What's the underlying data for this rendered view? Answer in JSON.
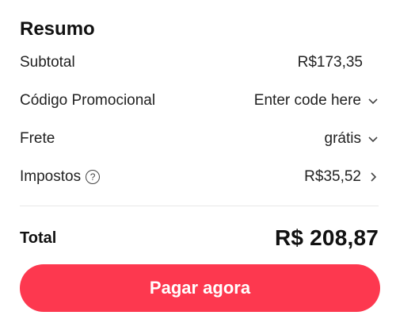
{
  "summary": {
    "title": "Resumo",
    "rows": [
      {
        "label": "Subtotal",
        "value": "R$173,35"
      },
      {
        "label": "Código Promocional",
        "value": "Enter code here"
      },
      {
        "label": "Frete",
        "value": "grátis"
      },
      {
        "label": "Impostos",
        "value": "R$35,52",
        "help": "?"
      }
    ],
    "total": {
      "label": "Total",
      "value": "R$ 208,87"
    },
    "pay_button": "Pagar agora"
  },
  "colors": {
    "accent": "#fd384f",
    "text": "#222222",
    "divider": "#e8e8e8"
  },
  "icons": {
    "promo": "chevron-down-icon",
    "shipping": "chevron-down-icon",
    "taxes_help": "help-circle-icon",
    "taxes_expand": "chevron-right-icon"
  }
}
